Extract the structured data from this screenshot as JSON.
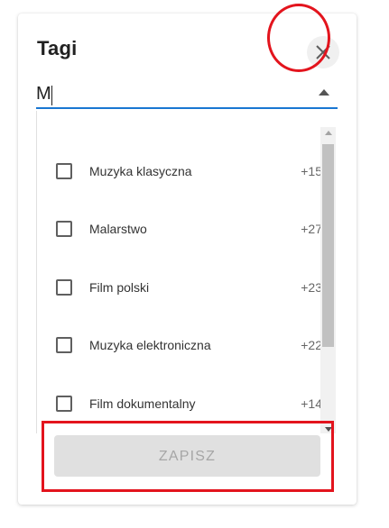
{
  "dialog": {
    "title": "Tagi",
    "close_icon": "close-icon"
  },
  "search": {
    "value": "M",
    "placeholder": ""
  },
  "tags": [
    {
      "label": "Muzyka klasyczna",
      "count": "+15",
      "checked": false
    },
    {
      "label": "Malarstwo",
      "count": "+27",
      "checked": false
    },
    {
      "label": "Film polski",
      "count": "+23",
      "checked": false
    },
    {
      "label": "Muzyka elektroniczna",
      "count": "+22",
      "checked": false
    },
    {
      "label": "Film dokumentalny",
      "count": "+14",
      "checked": false
    }
  ],
  "actions": {
    "save_label": "ZAPISZ",
    "save_enabled": false
  },
  "colors": {
    "accent": "#1976d2",
    "annotation": "#e3141d",
    "disabled_bg": "#e0e0e0",
    "disabled_text": "#a6a6a6"
  }
}
